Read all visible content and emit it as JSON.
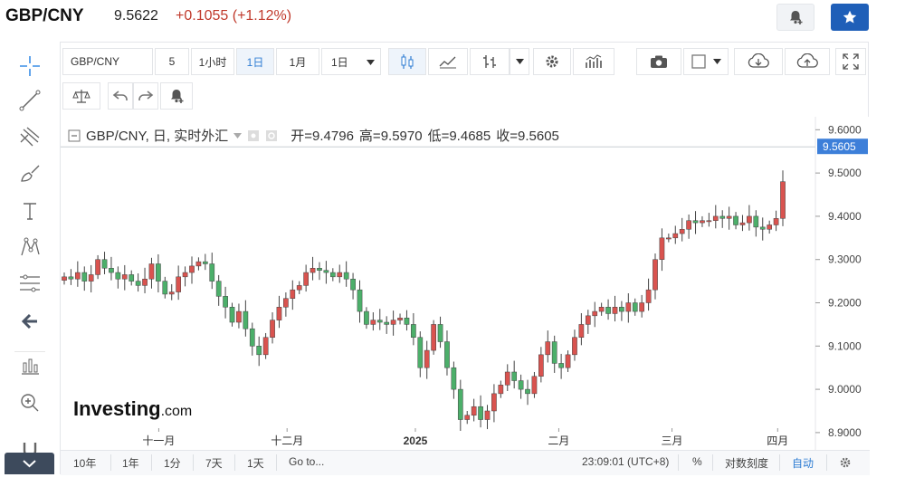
{
  "header": {
    "pair": "GBP/CNY",
    "price": "9.5622",
    "change": "+0.1055",
    "change_pct": "(+1.12%)"
  },
  "toolbar": {
    "symbol": "GBP/CNY",
    "intervals": [
      "5",
      "1小时",
      "1日",
      "1月"
    ],
    "active_interval": "1日",
    "interval_select": "1日"
  },
  "legend": {
    "title": "GBP/CNY, 日, 实时外汇",
    "open_label": "开=",
    "open": "9.4796",
    "high_label": "高=",
    "high": "9.5970",
    "low_label": "低=",
    "low": "9.4685",
    "close_label": "收=",
    "close": "9.5605"
  },
  "watermark": {
    "brand": "Investing",
    "suffix": ".com"
  },
  "bottombar": {
    "ranges": [
      "10年",
      "1年",
      "1分",
      "7天",
      "1天",
      "Go to..."
    ],
    "time": "23:09:01 (UTC+8)",
    "percent": "%",
    "log_scale": "对数刻度",
    "auto": "自动"
  },
  "colors": {
    "up": "#d9534f",
    "down": "#4caf6a",
    "accent": "#2f7dd3",
    "price_tag": "#3d7fd9"
  },
  "chart_data": {
    "type": "candlestick",
    "title": "GBP/CNY, 日, 实时外汇",
    "x_tick_labels": [
      "十一月",
      "十二月",
      "2025",
      "二月",
      "三月",
      "四月"
    ],
    "y_tick_labels": [
      "9.6000",
      "9.5000",
      "9.4000",
      "9.3000",
      "9.2000",
      "9.1000",
      "9.0000",
      "8.9000"
    ],
    "ylim": [
      8.86,
      9.63
    ],
    "current_price_label": "9.5605",
    "grid": false,
    "series": [
      {
        "values": [
          9.26,
          9.255,
          9.27,
          9.25,
          9.265,
          9.3,
          9.28,
          9.27,
          9.255,
          9.265,
          9.25,
          9.24,
          9.255,
          9.29,
          9.25,
          9.22,
          9.225,
          9.26,
          9.27,
          9.285,
          9.295,
          9.29,
          9.25,
          9.215,
          9.19,
          9.155,
          9.18,
          9.14,
          9.1,
          9.08,
          9.12,
          9.16,
          9.19,
          9.21,
          9.23,
          9.24,
          9.27,
          9.28,
          9.275,
          9.27,
          9.26,
          9.27,
          9.255,
          9.23,
          9.18,
          9.15,
          9.16,
          9.155,
          9.15,
          9.16,
          9.165,
          9.15,
          9.12,
          9.05,
          9.09,
          9.15,
          9.11,
          9.05,
          9.0,
          8.93,
          8.94,
          8.96,
          8.93,
          8.95,
          8.99,
          9.01,
          9.04,
          9.02,
          9.0,
          8.99,
          9.03,
          9.08,
          9.11,
          9.06,
          9.05,
          9.08,
          9.12,
          9.15,
          9.17,
          9.18,
          9.19,
          9.175,
          9.19,
          9.18,
          9.2,
          9.18,
          9.2,
          9.23,
          9.3,
          9.35,
          9.35,
          9.36,
          9.37,
          9.39,
          9.385,
          9.39,
          9.39,
          9.4,
          9.395,
          9.4,
          9.38,
          9.385,
          9.4,
          9.375,
          9.37,
          9.38,
          9.395,
          9.48
        ]
      }
    ]
  }
}
